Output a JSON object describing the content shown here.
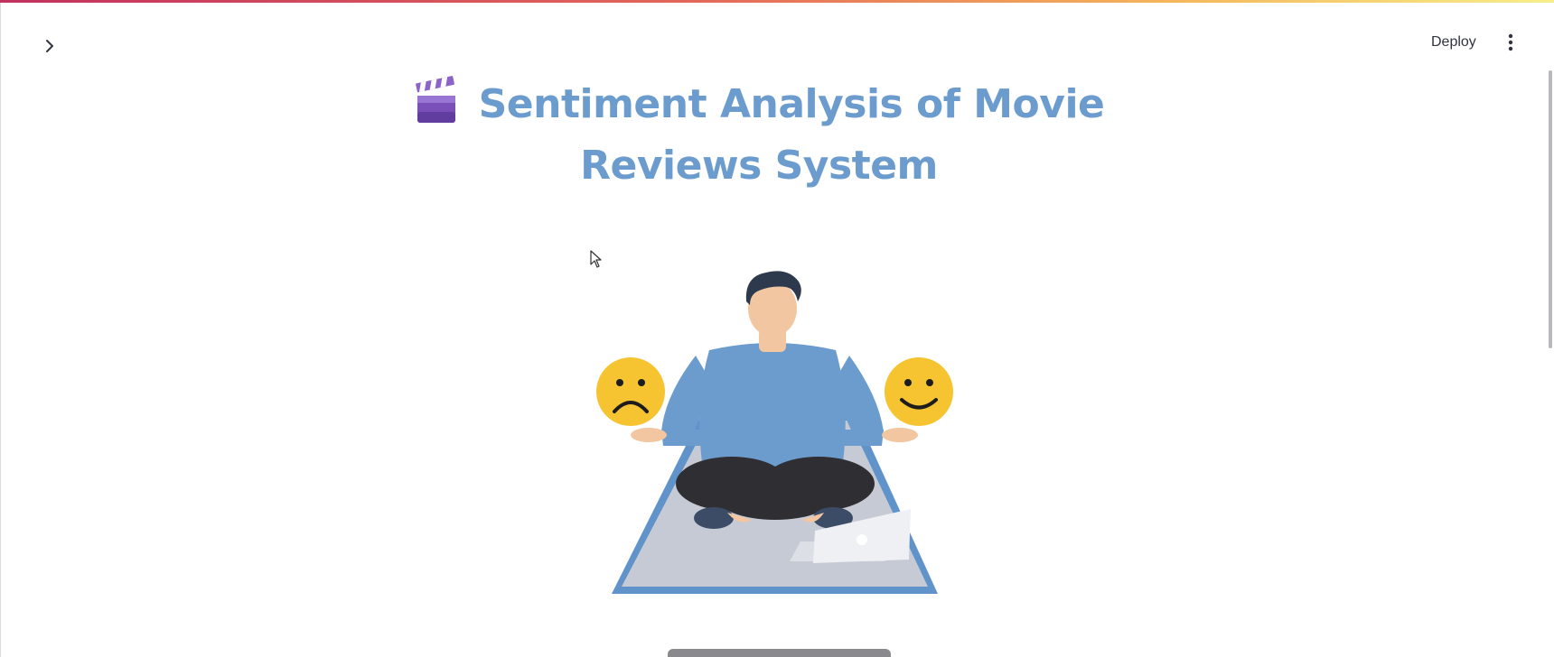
{
  "header": {
    "deploy_label": "Deploy",
    "sidebar_toggle_icon": "chevron-right-icon",
    "menu_icon": "vertical-ellipsis-icon"
  },
  "main": {
    "title_icon": "clapper-board-icon",
    "title": "Sentiment Analysis of Movie Reviews System",
    "hero_image": "person-meditating-with-sad-and-happy-emoji-icon"
  },
  "colors": {
    "title": "#6b9ccd",
    "shirt": "#6b9ccd",
    "emoji": "#f5c430",
    "mat": "#c5cad4",
    "mat_border": "#5f93c9",
    "accent_gradient_start": "#c2315f",
    "accent_gradient_end": "#f6ee8a"
  }
}
